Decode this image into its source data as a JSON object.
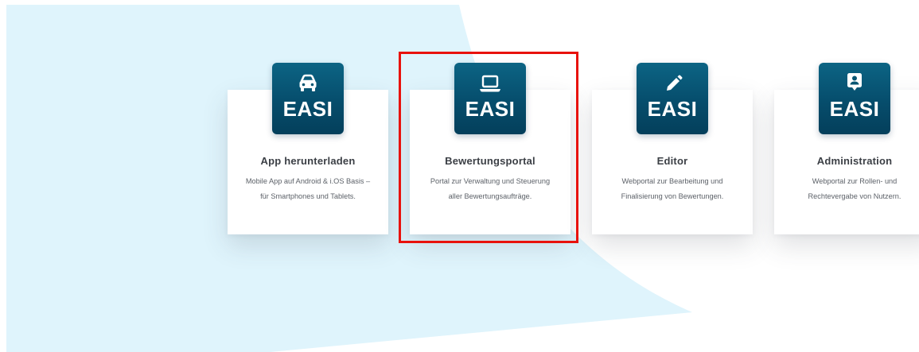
{
  "colors": {
    "background": "#ffffff",
    "accent_shape": "#dff4fc",
    "tile_gradient_top": "#0c6484",
    "tile_gradient_bottom": "#043f5b",
    "highlight": "#e8120c"
  },
  "cards": [
    {
      "id": "app",
      "icon": "car-icon",
      "tile_label": "EASI",
      "title": "App herunterladen",
      "desc_line1": "Mobile App auf Android & i.OS Basis –",
      "desc_line2": "für Smartphones und Tablets."
    },
    {
      "id": "portal",
      "icon": "laptop-icon",
      "tile_label": "EASI",
      "title": "Bewertungsportal",
      "desc_line1": "Portal zur Verwaltung und Steuerung",
      "desc_line2": "aller Bewertungsaufträge."
    },
    {
      "id": "editor",
      "icon": "pencil-icon",
      "tile_label": "EASI",
      "title": "Editor",
      "desc_line1": "Webportal zur Bearbeitung und",
      "desc_line2": "Finalisierung von Bewertungen."
    },
    {
      "id": "admin",
      "icon": "user-badge-icon",
      "tile_label": "EASI",
      "title": "Administration",
      "desc_line1": "Webportal zur Rollen- und",
      "desc_line2": "Rechtevergabe von Nutzern."
    }
  ]
}
